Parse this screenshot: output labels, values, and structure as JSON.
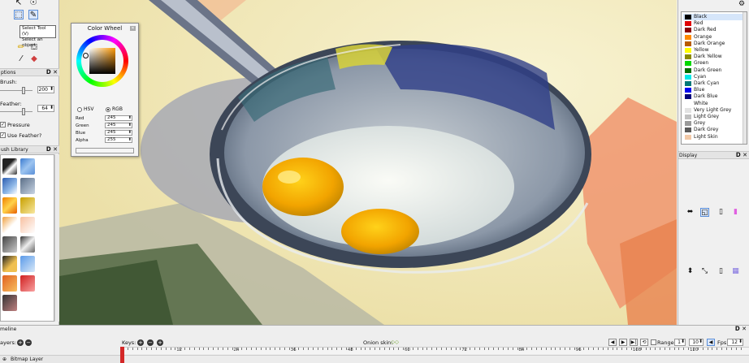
{
  "tools": {
    "tooltip_title": "Select Tool (V)",
    "tooltip_desc": "Select an object"
  },
  "options": {
    "title": "ptions",
    "brush_label": "Brush:",
    "brush_value": "200",
    "feather_label": "Feather:",
    "feather_value": "64",
    "pressure_label": "Pressure",
    "use_feather_label": "Use Feather?"
  },
  "brush_library": {
    "title": "ush Library"
  },
  "color_wheel": {
    "title": "Color Wheel",
    "hsv_label": "HSV",
    "rgb_label": "RGB",
    "mode": "rgb",
    "red_label": "Red",
    "red_value": "245",
    "green_label": "Green",
    "green_value": "245",
    "blue_label": "Blue",
    "blue_value": "245",
    "alpha_label": "Alpha",
    "alpha_value": "255"
  },
  "palette": {
    "items": [
      {
        "name": "Black",
        "color": "#000000"
      },
      {
        "name": "Red",
        "color": "#e00000"
      },
      {
        "name": "Dark Red",
        "color": "#8a0000"
      },
      {
        "name": "Orange",
        "color": "#ff8a00"
      },
      {
        "name": "Dark Orange",
        "color": "#b85c00"
      },
      {
        "name": "Yellow",
        "color": "#ffff00"
      },
      {
        "name": "Dark Yellow",
        "color": "#8a8a00"
      },
      {
        "name": "Green",
        "color": "#00d800"
      },
      {
        "name": "Dark Green",
        "color": "#006e00"
      },
      {
        "name": "Cyan",
        "color": "#00e8e8"
      },
      {
        "name": "Dark Cyan",
        "color": "#007878"
      },
      {
        "name": "Blue",
        "color": "#0000f0"
      },
      {
        "name": "Dark Blue",
        "color": "#00007a"
      },
      {
        "name": "White",
        "color": "#ffffff"
      },
      {
        "name": "Very Light Grey",
        "color": "#e2e2e2"
      },
      {
        "name": "Light Grey",
        "color": "#c0c0c0"
      },
      {
        "name": "Grey",
        "color": "#9a9a9a"
      },
      {
        "name": "Dark Grey",
        "color": "#5a5a5a"
      },
      {
        "name": "Light Skin",
        "color": "#f2c9a8"
      }
    ]
  },
  "display": {
    "title": "Display"
  },
  "timeline": {
    "title": "meline",
    "layers_label": "ayers:",
    "keys_label": "Keys:",
    "onion_label": "Onion skin:",
    "range_label": "Range",
    "range_start": "1",
    "range_end": "10",
    "fps_label": "Fps:",
    "fps_value": "12",
    "layer_name": "Bitmap Layer",
    "ruler_numbers": [
      "12",
      "24",
      "36",
      "48",
      "60",
      "72",
      "84",
      "96",
      "108",
      "120"
    ]
  }
}
